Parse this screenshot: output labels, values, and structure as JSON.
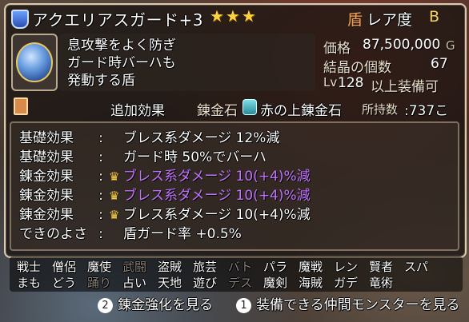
{
  "item": {
    "name": "アクエリアスガード+3",
    "stars": "★★★",
    "rarity_label": "レア度",
    "rarity_value": "B",
    "description": [
      "息攻撃をよく防ぎ",
      "ガード時バーハも",
      "発動する盾"
    ],
    "price_label": "価格",
    "price_value": "87,500,000",
    "price_unit": "G",
    "crystal_label": "結晶の個数",
    "crystal_value": "67",
    "level_prefix": "Lv",
    "level_value": "128",
    "level_suffix": "以上装備可"
  },
  "tabs": {
    "extra_effects": "追加効果",
    "alchemy_stone_label": "錬金石",
    "alchemy_stone_value": "赤の上錬金石",
    "owned_label": "所持数",
    "owned_value": ":737こ"
  },
  "effects": [
    {
      "type": "基礎効果",
      "colon": ":",
      "text": "ブレス系ダメージ 12%減",
      "crown": "",
      "highlight": false
    },
    {
      "type": "基礎効果",
      "colon": ":",
      "text": "ガード時 50%でバーハ",
      "crown": "",
      "highlight": false
    },
    {
      "type": "錬金効果",
      "colon": ":",
      "text": "ブレス系ダメージ 10(+4)%減",
      "crown": "♛",
      "highlight": true
    },
    {
      "type": "錬金効果",
      "colon": ":",
      "text": "ブレス系ダメージ 10(+4)%減",
      "crown": "♛",
      "highlight": true
    },
    {
      "type": "錬金効果",
      "colon": ":",
      "text": "ブレス系ダメージ 10(+4)%減",
      "crown": "♛",
      "highlight": false
    },
    {
      "type": "できのよさ",
      "colon": ":",
      "text": "盾ガード率 +0.5%",
      "crown": "",
      "highlight": false
    }
  ],
  "jobs_row1": [
    {
      "label": "戦士",
      "dim": false
    },
    {
      "label": "僧侶",
      "dim": false
    },
    {
      "label": "魔使",
      "dim": false
    },
    {
      "label": "武闘",
      "dim": true
    },
    {
      "label": "盗賊",
      "dim": false
    },
    {
      "label": "旅芸",
      "dim": false
    },
    {
      "label": "バト",
      "dim": true
    },
    {
      "label": "パラ",
      "dim": false
    },
    {
      "label": "魔戦",
      "dim": false
    },
    {
      "label": "レン",
      "dim": false
    },
    {
      "label": "賢者",
      "dim": false
    },
    {
      "label": "スパ",
      "dim": false
    }
  ],
  "jobs_row2": [
    {
      "label": "まも",
      "dim": false
    },
    {
      "label": "どう",
      "dim": false
    },
    {
      "label": "踊り",
      "dim": true
    },
    {
      "label": "占い",
      "dim": false
    },
    {
      "label": "天地",
      "dim": false
    },
    {
      "label": "遊び",
      "dim": false
    },
    {
      "label": "デス",
      "dim": true
    },
    {
      "label": "魔剣",
      "dim": false
    },
    {
      "label": "海賊",
      "dim": false
    },
    {
      "label": "ガデ",
      "dim": false
    },
    {
      "label": "竜術",
      "dim": false
    }
  ],
  "footer": {
    "btn2_num": "2",
    "btn2_label": "錬金強化を見る",
    "btn1_num": "1",
    "btn1_label": "装備できる仲間モンスターを見る"
  },
  "colors": {
    "highlight": "#c070ff",
    "stars": "#ffd040",
    "frame": "#d8cbb2"
  },
  "icons": [
    "shield-icon",
    "orb-shield-icon",
    "book-icon",
    "gem-icon",
    "crown-icon"
  ]
}
